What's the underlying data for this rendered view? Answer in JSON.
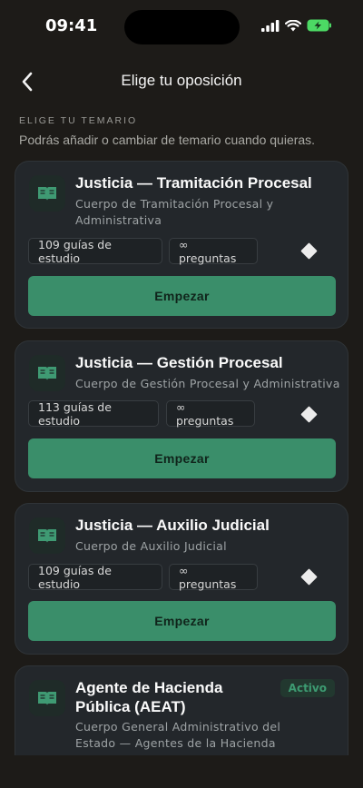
{
  "status_bar": {
    "time": "09:41"
  },
  "nav": {
    "title": "Elige tu oposición"
  },
  "section": {
    "label": "ELIGE TU TEMARIO",
    "subtitle": "Podrás añadir o cambiar de temario cuando quieras."
  },
  "cards": [
    {
      "title": "Justicia — Tramitación Procesal",
      "subtitle_line1": "Cuerpo de Tramitación Procesal y",
      "subtitle_line2": "Administrativa",
      "guides": "109 guías de estudio",
      "questions": "∞ preguntas",
      "button": "Empezar"
    },
    {
      "title": "Justicia — Gestión Procesal",
      "subtitle_line1": "Cuerpo de Gestión Procesal y Administrativa",
      "guides": "113 guías de estudio",
      "questions": "∞ preguntas",
      "button": "Empezar"
    },
    {
      "title": "Justicia — Auxilio Judicial",
      "subtitle_line1": "Cuerpo de Auxilio Judicial",
      "guides": "109 guías de estudio",
      "questions": "∞ preguntas",
      "button": "Empezar"
    },
    {
      "title_line1": "Agente de Hacienda",
      "title_line2": "Pública (AEAT)",
      "badge": "Activo",
      "subtitle_line1": "Cuerpo General Administrativo del",
      "subtitle_line2": "Estado — Agentes de la Hacienda"
    }
  ],
  "colors": {
    "background": "#1d1b18",
    "card": "#23272b",
    "accent": "#3a8e6a",
    "icon": "#3f9a73"
  },
  "icons": {
    "card": "book-open-icon",
    "back": "chevron-left-icon",
    "favorite": "diamond-icon"
  }
}
